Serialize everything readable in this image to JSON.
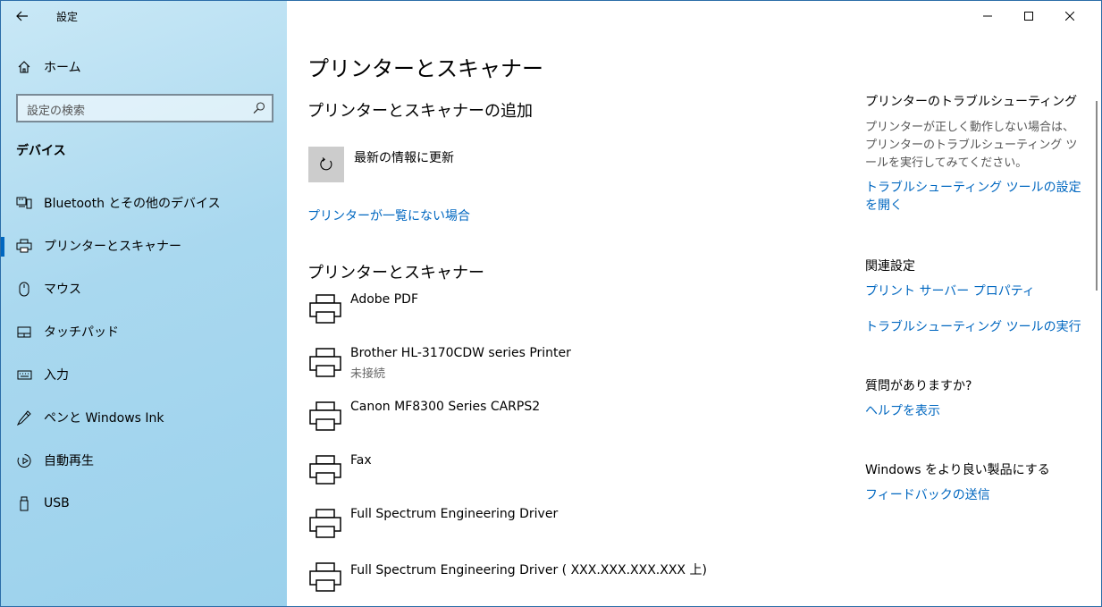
{
  "app": {
    "title": "設定"
  },
  "sidebar": {
    "home_label": "ホーム",
    "search_placeholder": "設定の検索",
    "section": "デバイス",
    "items": [
      {
        "label": "Bluetooth とその他のデバイス",
        "icon": "bluetooth-devices-icon"
      },
      {
        "label": "プリンターとスキャナー",
        "icon": "printer-icon"
      },
      {
        "label": "マウス",
        "icon": "mouse-icon"
      },
      {
        "label": "タッチパッド",
        "icon": "touchpad-icon"
      },
      {
        "label": "入力",
        "icon": "keyboard-icon"
      },
      {
        "label": "ペンと Windows Ink",
        "icon": "pen-icon"
      },
      {
        "label": "自動再生",
        "icon": "autoplay-icon"
      },
      {
        "label": "USB",
        "icon": "usb-icon"
      }
    ],
    "active_index": 1
  },
  "main": {
    "title": "プリンターとスキャナー",
    "add_heading": "プリンターとスキャナーの追加",
    "refresh_label": "最新の情報に更新",
    "not_listed_link": "プリンターが一覧にない場合",
    "printers_heading": "プリンターとスキャナー",
    "printers": [
      {
        "name": "Adobe PDF",
        "status": ""
      },
      {
        "name": "Brother HL-3170CDW series Printer",
        "status": "未接続"
      },
      {
        "name": "Canon MF8300 Series CARPS2",
        "status": ""
      },
      {
        "name": "Fax",
        "status": ""
      },
      {
        "name": "Full Spectrum Engineering Driver",
        "status": ""
      },
      {
        "name": "Full Spectrum Engineering Driver ( XXX.XXX.XXX.XXX 上)",
        "status": ""
      }
    ]
  },
  "right": {
    "troubleshoot_heading": "プリンターのトラブルシューティング",
    "troubleshoot_text": "プリンターが正しく動作しない場合は、プリンターのトラブルシューティング ツールを実行してみてください。",
    "troubleshoot_link": "トラブルシューティング ツールの設定を開く",
    "related_heading": "関連設定",
    "print_server_link": "プリント サーバー プロパティ",
    "run_troubleshooter_link": "トラブルシューティング ツールの実行",
    "question_heading": "質問がありますか?",
    "help_link": "ヘルプを表示",
    "improve_heading": "Windows をより良い製品にする",
    "feedback_link": "フィードバックの送信"
  },
  "colors": {
    "accent": "#0067c0",
    "sidebar": "#a9d8ef"
  }
}
